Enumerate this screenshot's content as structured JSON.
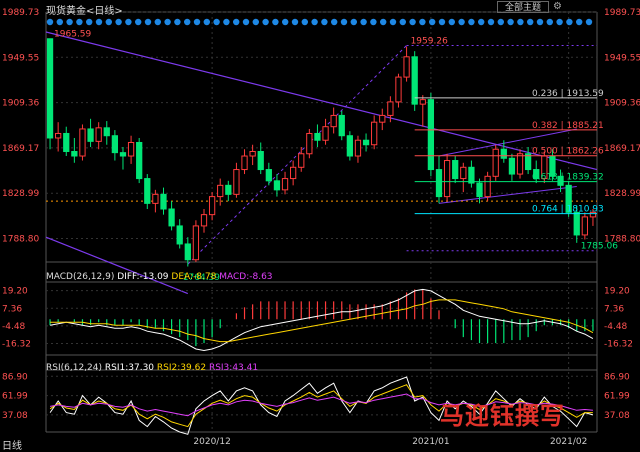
{
  "toolbar": {
    "title": "现货黄金<日线>",
    "main_button": "全部主题",
    "settings_icon": "gear-icon"
  },
  "watermark": "马迎钰撰写",
  "period_tab": "日线",
  "colors": {
    "up": "#ff3b3b",
    "down": "#00e676",
    "trendline": "#7c3aed",
    "grid": "#333333",
    "dots": "#1e88e5"
  },
  "chart_data": {
    "type": "candlestick",
    "price_ticks": [
      "1989.73",
      "1949.55",
      "1909.36",
      "1869.17",
      "1828.99",
      "1788.80"
    ],
    "x_ticks": [
      "2020/12",
      "2021/01",
      "2021/02"
    ],
    "annotations": {
      "high": "1965.59",
      "high2": "1959.26",
      "low": "1764.39",
      "low2": "1785.06"
    },
    "fib_levels": [
      {
        "label": "0.236 | 1913.59",
        "value": 1913.59,
        "color": "#cccccc"
      },
      {
        "label": "0.382 | 1885.21",
        "value": 1885.21,
        "color": "#ff4d4d"
      },
      {
        "label": "0.500 | 1862.26",
        "value": 1862.26,
        "color": "#ff4d4d"
      },
      {
        "label": "0.618 | 1839.32",
        "value": 1839.32,
        "color": "#00e676"
      },
      {
        "label": "0.764 | 1810.93",
        "value": 1810.93,
        "color": "#00e5ff"
      }
    ],
    "ohlc": [
      [
        1966,
        1966,
        1868,
        1878
      ],
      [
        1878,
        1892,
        1866,
        1882
      ],
      [
        1882,
        1888,
        1862,
        1866
      ],
      [
        1866,
        1878,
        1856,
        1862
      ],
      [
        1862,
        1890,
        1858,
        1886
      ],
      [
        1886,
        1895,
        1870,
        1875
      ],
      [
        1875,
        1892,
        1868,
        1887
      ],
      [
        1887,
        1893,
        1872,
        1880
      ],
      [
        1880,
        1885,
        1858,
        1865
      ],
      [
        1865,
        1870,
        1850,
        1862
      ],
      [
        1862,
        1880,
        1855,
        1874
      ],
      [
        1874,
        1878,
        1838,
        1842
      ],
      [
        1842,
        1846,
        1815,
        1820
      ],
      [
        1820,
        1832,
        1812,
        1828
      ],
      [
        1828,
        1834,
        1810,
        1815
      ],
      [
        1815,
        1822,
        1796,
        1800
      ],
      [
        1800,
        1806,
        1780,
        1784
      ],
      [
        1784,
        1790,
        1764,
        1770
      ],
      [
        1770,
        1805,
        1768,
        1800
      ],
      [
        1800,
        1815,
        1794,
        1810
      ],
      [
        1810,
        1830,
        1805,
        1826
      ],
      [
        1826,
        1842,
        1818,
        1836
      ],
      [
        1836,
        1840,
        1822,
        1828
      ],
      [
        1828,
        1856,
        1825,
        1850
      ],
      [
        1850,
        1868,
        1846,
        1862
      ],
      [
        1862,
        1872,
        1854,
        1866
      ],
      [
        1866,
        1874,
        1846,
        1850
      ],
      [
        1850,
        1856,
        1836,
        1840
      ],
      [
        1840,
        1846,
        1826,
        1832
      ],
      [
        1832,
        1848,
        1828,
        1842
      ],
      [
        1842,
        1858,
        1836,
        1852
      ],
      [
        1852,
        1870,
        1848,
        1864
      ],
      [
        1864,
        1886,
        1860,
        1882
      ],
      [
        1882,
        1890,
        1870,
        1876
      ],
      [
        1876,
        1895,
        1872,
        1888
      ],
      [
        1888,
        1905,
        1882,
        1898
      ],
      [
        1898,
        1902,
        1876,
        1880
      ],
      [
        1880,
        1884,
        1858,
        1862
      ],
      [
        1862,
        1880,
        1856,
        1876
      ],
      [
        1876,
        1882,
        1866,
        1872
      ],
      [
        1872,
        1898,
        1868,
        1892
      ],
      [
        1892,
        1904,
        1885,
        1898
      ],
      [
        1898,
        1915,
        1892,
        1910
      ],
      [
        1910,
        1935,
        1905,
        1932
      ],
      [
        1932,
        1959,
        1928,
        1950
      ],
      [
        1950,
        1955,
        1902,
        1908
      ],
      [
        1908,
        1916,
        1888,
        1912
      ],
      [
        1912,
        1918,
        1844,
        1850
      ],
      [
        1850,
        1862,
        1820,
        1826
      ],
      [
        1826,
        1864,
        1822,
        1858
      ],
      [
        1858,
        1862,
        1838,
        1842
      ],
      [
        1842,
        1856,
        1830,
        1852
      ],
      [
        1852,
        1858,
        1834,
        1838
      ],
      [
        1838,
        1842,
        1820,
        1826
      ],
      [
        1826,
        1848,
        1822,
        1844
      ],
      [
        1844,
        1872,
        1840,
        1868
      ],
      [
        1868,
        1876,
        1856,
        1860
      ],
      [
        1860,
        1864,
        1840,
        1846
      ],
      [
        1846,
        1868,
        1842,
        1864
      ],
      [
        1864,
        1870,
        1846,
        1850
      ],
      [
        1850,
        1858,
        1838,
        1842
      ],
      [
        1842,
        1866,
        1838,
        1862
      ],
      [
        1862,
        1868,
        1840,
        1844
      ],
      [
        1844,
        1850,
        1830,
        1836
      ],
      [
        1836,
        1840,
        1808,
        1812
      ],
      [
        1812,
        1818,
        1785,
        1792
      ],
      [
        1792,
        1812,
        1788,
        1808
      ],
      [
        1808,
        1815,
        1800,
        1812
      ]
    ],
    "macd": {
      "label": "MACD(26,12,9)",
      "diff_label": "DIFF:-13.09",
      "dea_label": "DEA:-8.78",
      "macd_label": "MACD:-8.63",
      "ticks": [
        "19.20",
        "7.36",
        "-4.48",
        "-16.32"
      ],
      "diff": [
        -4,
        -3,
        -2,
        -3,
        -4,
        -5,
        -4,
        -5,
        -6,
        -6,
        -5,
        -6,
        -8,
        -9,
        -10,
        -12,
        -14,
        -17,
        -20,
        -21,
        -20,
        -18,
        -15,
        -12,
        -9,
        -7,
        -5,
        -4,
        -3,
        -2,
        -1,
        0,
        1,
        2,
        3,
        4,
        5,
        5,
        6,
        7,
        8,
        9,
        11,
        13,
        16,
        19,
        20,
        19,
        16,
        13,
        10,
        6,
        4,
        2,
        1,
        0,
        -1,
        -2,
        -3,
        -3,
        -2,
        -1,
        -2,
        -3,
        -5,
        -8,
        -10,
        -13
      ],
      "dea": [
        -2,
        -2,
        -2,
        -2,
        -2,
        -3,
        -3,
        -3,
        -4,
        -4,
        -4,
        -4,
        -5,
        -6,
        -6,
        -7,
        -8,
        -10,
        -11,
        -13,
        -14,
        -15,
        -15,
        -14,
        -13,
        -12,
        -11,
        -10,
        -9,
        -8,
        -7,
        -6,
        -5,
        -4,
        -3,
        -2,
        -1,
        0,
        1,
        2,
        3,
        4,
        5,
        6,
        7,
        9,
        10,
        12,
        13,
        13,
        13,
        12,
        11,
        10,
        9,
        8,
        7,
        5,
        4,
        3,
        2,
        1,
        0,
        -1,
        -2,
        -4,
        -6,
        -9
      ],
      "hist": [
        -4,
        -2,
        0,
        -2,
        -4,
        -4,
        -2,
        -4,
        -4,
        -4,
        -2,
        -4,
        -6,
        -6,
        -8,
        -10,
        -12,
        -14,
        -18,
        -16,
        -12,
        -6,
        0,
        4,
        8,
        10,
        12,
        12,
        12,
        12,
        12,
        12,
        12,
        12,
        12,
        12,
        12,
        10,
        10,
        10,
        10,
        10,
        12,
        14,
        18,
        20,
        20,
        14,
        6,
        0,
        -6,
        -12,
        -14,
        -16,
        -16,
        -16,
        -16,
        -14,
        -14,
        -12,
        -8,
        -4,
        -4,
        -4,
        -6,
        -8,
        -8,
        -8
      ]
    },
    "rsi": {
      "label": "RSI(6,12,24)",
      "rsi1_label": "RSI1:37.30",
      "rsi2_label": "RSI2:39.62",
      "rsi3_label": "RSI3:43.41",
      "ticks": [
        "86.90",
        "61.99",
        "37.08"
      ],
      "rsi1": [
        40,
        55,
        40,
        38,
        62,
        50,
        60,
        52,
        40,
        38,
        55,
        30,
        22,
        35,
        28,
        20,
        15,
        12,
        45,
        55,
        62,
        68,
        55,
        68,
        72,
        68,
        50,
        40,
        35,
        55,
        62,
        70,
        78,
        65,
        72,
        78,
        55,
        40,
        55,
        52,
        68,
        72,
        78,
        82,
        86,
        55,
        60,
        40,
        30,
        55,
        45,
        55,
        48,
        38,
        52,
        68,
        58,
        48,
        58,
        50,
        45,
        60,
        48,
        42,
        32,
        22,
        40,
        37
      ],
      "rsi2": [
        45,
        52,
        46,
        44,
        56,
        50,
        55,
        52,
        45,
        43,
        50,
        38,
        32,
        38,
        34,
        28,
        25,
        22,
        38,
        45,
        52,
        56,
        52,
        58,
        62,
        60,
        52,
        46,
        42,
        50,
        55,
        60,
        66,
        60,
        64,
        68,
        58,
        48,
        54,
        52,
        60,
        64,
        68,
        72,
        76,
        60,
        62,
        50,
        42,
        52,
        48,
        52,
        50,
        44,
        50,
        58,
        55,
        50,
        55,
        52,
        48,
        55,
        50,
        46,
        40,
        34,
        40,
        40
      ],
      "rsi3": [
        48,
        50,
        48,
        47,
        52,
        50,
        52,
        51,
        48,
        47,
        50,
        45,
        42,
        44,
        42,
        40,
        38,
        36,
        42,
        46,
        50,
        52,
        50,
        54,
        56,
        55,
        52,
        50,
        48,
        51,
        53,
        56,
        59,
        56,
        58,
        60,
        56,
        52,
        54,
        53,
        56,
        58,
        60,
        62,
        64,
        58,
        58,
        53,
        50,
        52,
        50,
        52,
        51,
        48,
        50,
        54,
        53,
        51,
        53,
        52,
        50,
        52,
        51,
        49,
        46,
        43,
        44,
        43
      ]
    }
  }
}
